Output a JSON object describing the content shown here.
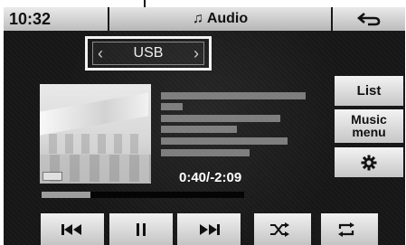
{
  "status_bar": {
    "time": "10:32"
  },
  "header": {
    "title": "Audio",
    "title_icon": "music-note-icon",
    "back_icon": "back-arrow-icon"
  },
  "source": {
    "label": "USB"
  },
  "side_menu": {
    "list_label": "List",
    "music_menu_label": "Music menu",
    "settings_icon": "gear-icon"
  },
  "playback": {
    "time_display": "0:40/-2:09",
    "progress_fraction": 0.24
  },
  "controls": {
    "prev_icon": "skip-back-icon",
    "pause_icon": "pause-icon",
    "next_icon": "skip-forward-icon",
    "shuffle_icon": "shuffle-icon",
    "repeat_icon": "repeat-icon"
  }
}
